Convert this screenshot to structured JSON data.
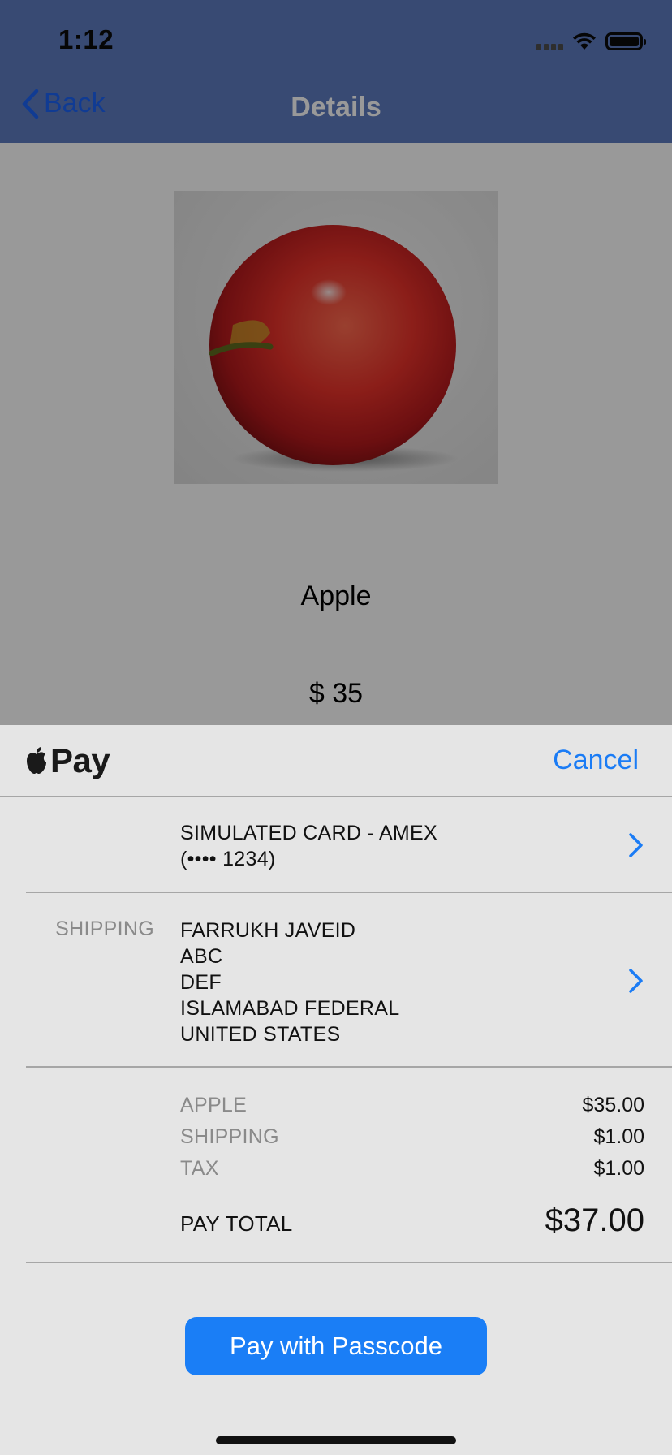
{
  "status_bar": {
    "time": "1:12"
  },
  "nav": {
    "back_label": "Back",
    "title": "Details"
  },
  "product": {
    "name": "Apple",
    "price": "$ 35"
  },
  "pay_sheet": {
    "logo_text": "Pay",
    "cancel_label": "Cancel",
    "card": {
      "line1": "SIMULATED CARD - AMEX",
      "line2": "(•••• 1234)"
    },
    "shipping": {
      "label": "SHIPPING",
      "lines": [
        "FARRUKH JAVEID",
        "ABC",
        "DEF",
        "ISLAMABAD FEDERAL",
        "UNITED STATES"
      ]
    },
    "summary": [
      {
        "label": "APPLE",
        "value": "$35.00"
      },
      {
        "label": "SHIPPING",
        "value": "$1.00"
      },
      {
        "label": "TAX",
        "value": "$1.00"
      }
    ],
    "total": {
      "label": "PAY TOTAL",
      "value": "$37.00"
    },
    "pay_button_label": "Pay with Passcode"
  },
  "colors": {
    "nav_bar": "#5e7cc0",
    "accent_blue": "#1b7cf5",
    "sheet_background": "#e5e5e5"
  },
  "icons": [
    "chevron-left-icon",
    "wifi-icon",
    "battery-icon",
    "apple-logo-icon",
    "chevron-right-icon"
  ]
}
